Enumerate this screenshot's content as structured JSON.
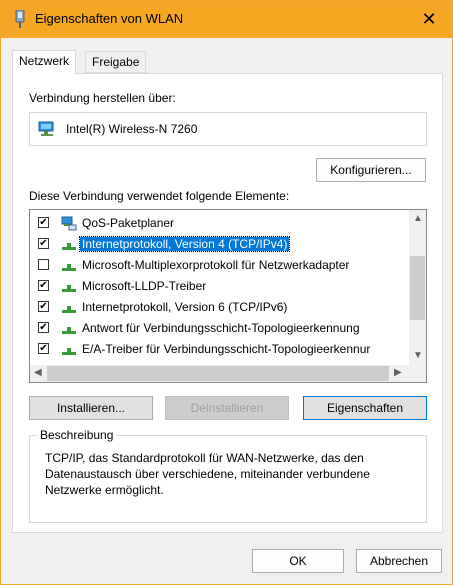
{
  "window": {
    "title": "Eigenschaften von WLAN",
    "close_glyph": "✕"
  },
  "tabs": [
    {
      "label": "Netzwerk",
      "active": true
    },
    {
      "label": "Freigabe",
      "active": false
    }
  ],
  "connection": {
    "label": "Verbindung herstellen über:",
    "adapter": "Intel(R) Wireless-N 7260"
  },
  "buttons": {
    "configure": "Konfigurieren...",
    "install": "Installieren...",
    "uninstall": "Deinstallieren",
    "properties": "Eigenschaften",
    "ok": "OK",
    "cancel": "Abbrechen"
  },
  "items_label": "Diese Verbindung verwendet folgende Elemente:",
  "items": [
    {
      "label": "QoS-Paketplaner",
      "checked": true,
      "icon": "network-service-icon",
      "selected": false
    },
    {
      "label": "Internetprotokoll, Version 4 (TCP/IPv4)",
      "checked": true,
      "icon": "protocol-icon",
      "selected": true
    },
    {
      "label": "Microsoft-Multiplexorprotokoll für Netzwerkadapter",
      "checked": false,
      "icon": "protocol-icon",
      "selected": false
    },
    {
      "label": "Microsoft-LLDP-Treiber",
      "checked": true,
      "icon": "protocol-icon",
      "selected": false
    },
    {
      "label": "Internetprotokoll, Version 6 (TCP/IPv6)",
      "checked": true,
      "icon": "protocol-icon",
      "selected": false
    },
    {
      "label": "Antwort für Verbindungsschicht-Topologieerkennung",
      "checked": true,
      "icon": "protocol-icon",
      "selected": false
    },
    {
      "label": "E/A-Treiber für Verbindungsschicht-Topologieerkennur",
      "checked": true,
      "icon": "protocol-icon",
      "selected": false
    }
  ],
  "description": {
    "title": "Beschreibung",
    "text": "TCP/IP, das Standardprotokoll für WAN-Netzwerke, das den Datenaustausch über verschiedene, miteinander verbundene Netzwerke ermöglicht."
  },
  "colors": {
    "titlebar": "#f5a623",
    "selection": "#0078d7"
  }
}
